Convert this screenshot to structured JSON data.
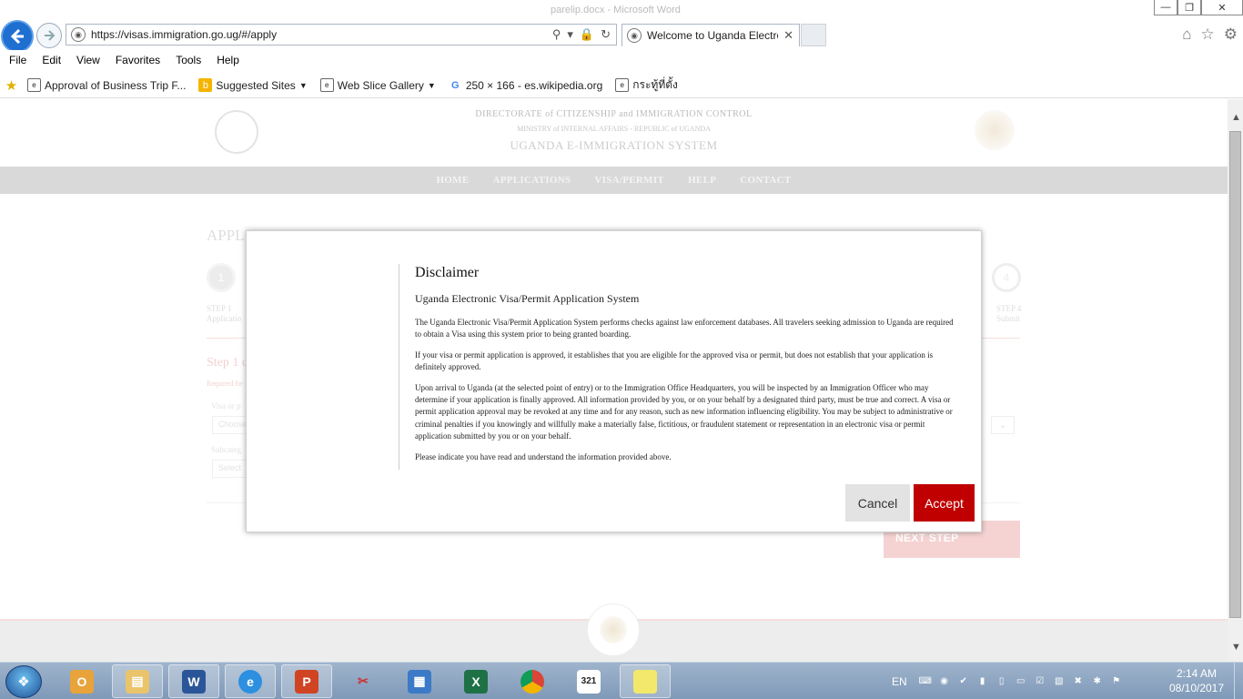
{
  "browser": {
    "window_title_ghost": "parelip.docx - Microsoft Word",
    "url": "https://visas.immigration.go.ug/#/apply",
    "tab_title": "Welcome to Uganda Electroni...",
    "menu": [
      "File",
      "Edit",
      "View",
      "Favorites",
      "Tools",
      "Help"
    ],
    "favorites": [
      {
        "label": "Approval of Business Trip F...",
        "icon": "document-icon",
        "dropdown": false
      },
      {
        "label": "Suggested Sites",
        "icon": "bing-icon",
        "dropdown": true
      },
      {
        "label": "Web Slice Gallery",
        "icon": "slice-icon",
        "dropdown": true
      },
      {
        "label": "250 × 166 - es.wikipedia.org",
        "icon": "google-icon",
        "dropdown": false
      },
      {
        "label": "กระทู้ที่ตั้ง",
        "icon": "document-icon",
        "dropdown": false
      }
    ]
  },
  "site": {
    "header_line1": "DIRECTORATE of CITIZENSHIP and IMMIGRATION CONTROL",
    "header_line2": "MINISTRY of INTERNAL AFFAIRS - REPUBLIC of UGANDA",
    "header_line3": "UGANDA E-IMMIGRATION SYSTEM",
    "nav": [
      "HOME",
      "APPLICATIONS",
      "VISA/PERMIT",
      "HELP",
      "CONTACT"
    ],
    "page_title": "APPL",
    "step1_number": "1",
    "step1_label_a": "STEP 1",
    "step1_label_b": "Applicatio",
    "step_last_number": "4",
    "step_last_label_a": "STEP 4",
    "step_last_label_b": "Submit",
    "step_heading": "Step 1 c",
    "required_note": "Required fie",
    "field1_label": "Visa or p",
    "field1_value": "Choose",
    "field2_label": "Subcateg",
    "field2_value": "Select",
    "next_button": "NEXT STEP"
  },
  "modal": {
    "title": "Disclaimer",
    "subtitle": "Uganda Electronic Visa/Permit Application System",
    "paragraphs": [
      "The Uganda Electronic Visa/Permit Application System performs checks against law enforcement databases. All travelers seeking admission to Uganda are required to obtain a Visa using this system prior to being granted boarding.",
      "If your visa or permit application is approved, it establishes that you are eligible for the approved visa or permit, but does not establish that your application is definitely approved.",
      "Upon arrival to Uganda (at the selected point of entry) or to the Immigration Office Headquarters, you will be inspected by an Immigration Officer who may determine if your application is finally approved. All information provided by you, or on your behalf by a designated third party, must be true and correct. A visa or permit application approval may be revoked at any time and for any reason, such as new information influencing eligibility. You may be subject to administrative or criminal penalties if you knowingly and willfully make a materially false, fictitious, or fraudulent statement or representation in an electronic visa or permit application submitted by you or on your behalf.",
      "Please indicate you have read and understand the information provided above."
    ],
    "cancel_label": "Cancel",
    "accept_label": "Accept",
    "accent_color": "#c00000"
  },
  "taskbar": {
    "apps": [
      "outlook-icon",
      "explorer-icon",
      "word-icon",
      "ie-icon",
      "powerpoint-icon",
      "snipping-icon",
      "windows-icon",
      "excel-icon",
      "chrome-icon",
      "calendar-icon",
      "sticky-notes-icon"
    ],
    "language": "EN",
    "time": "2:14 AM",
    "date": "08/10/2017"
  }
}
